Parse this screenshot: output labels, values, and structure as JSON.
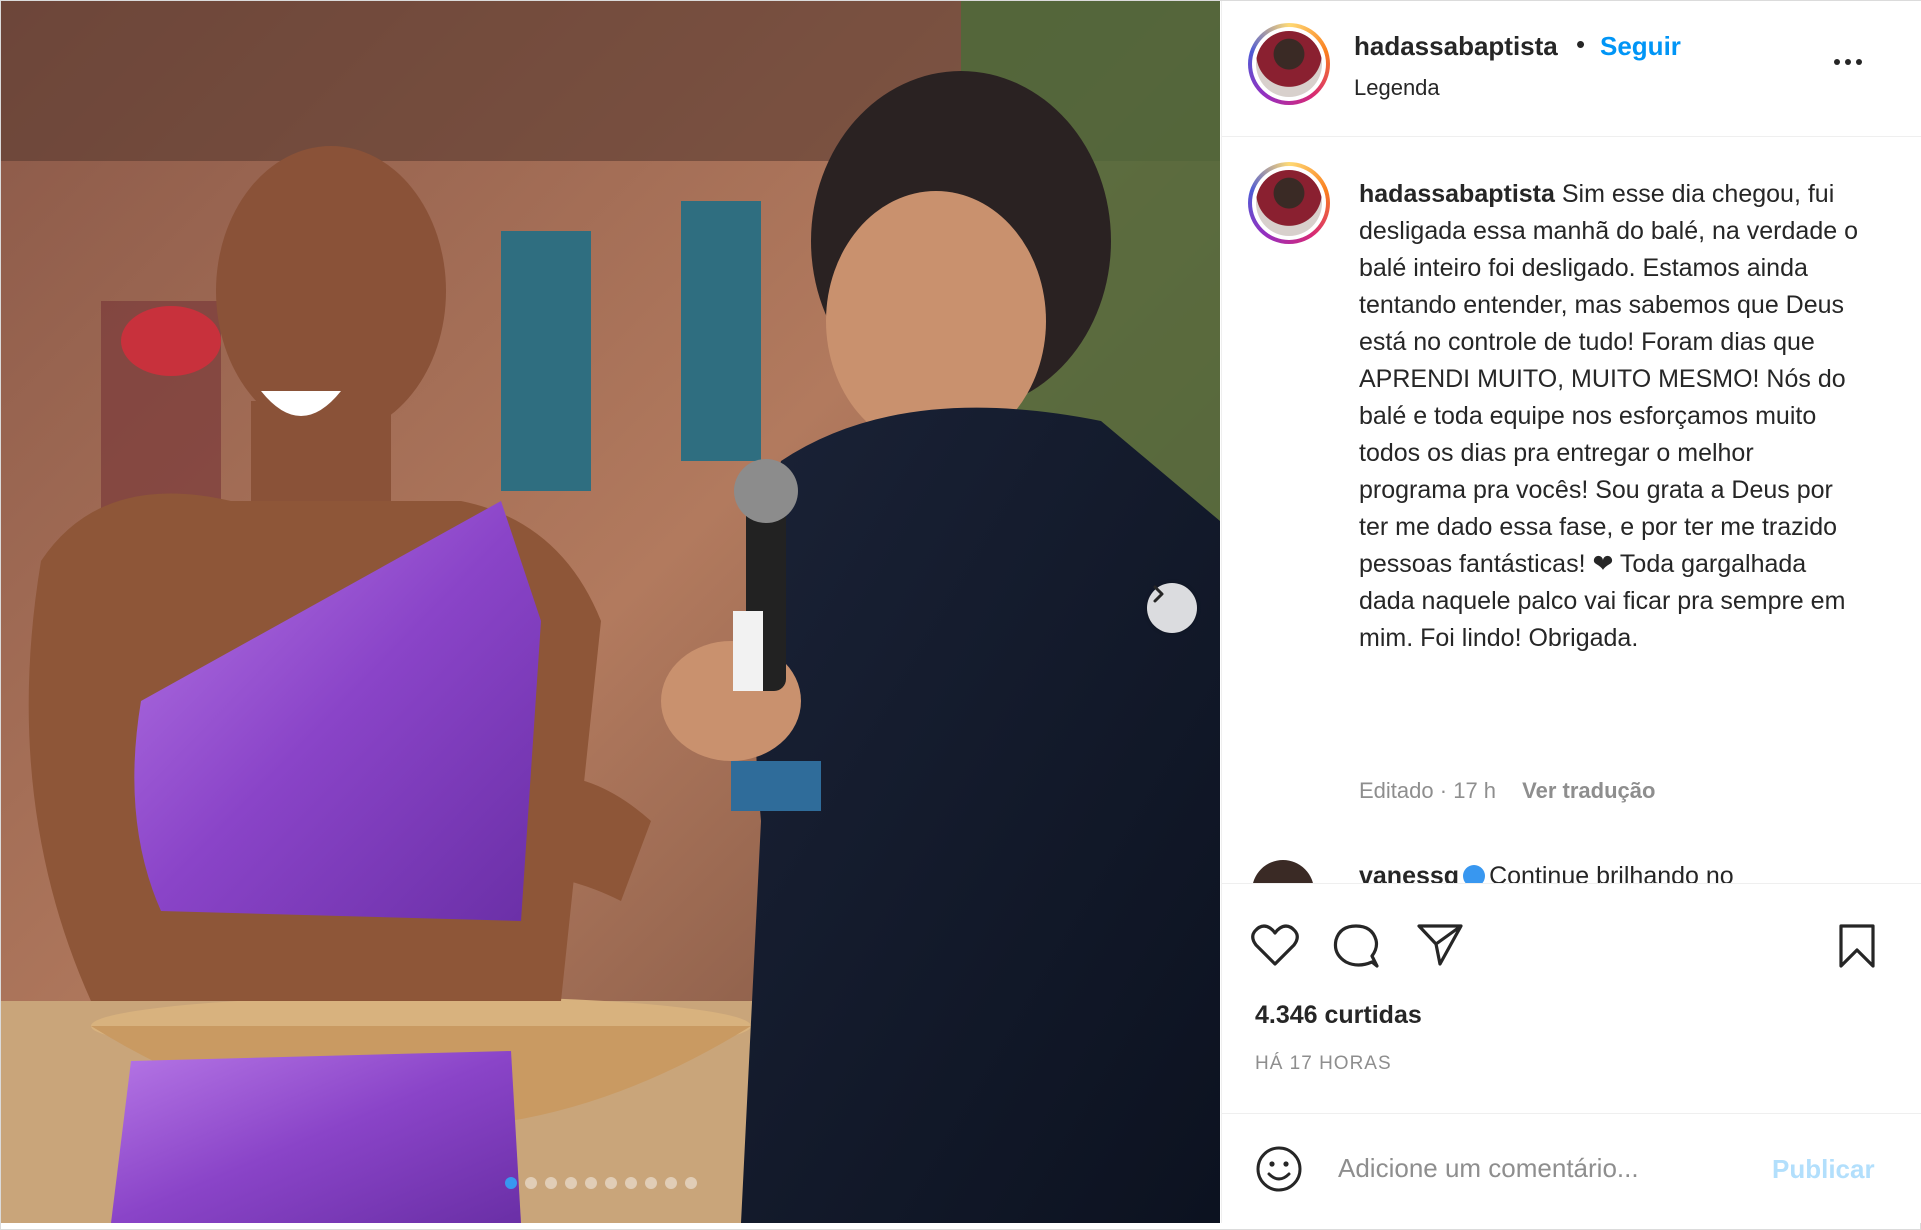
{
  "post": {
    "username": "hadassabaptista",
    "separator": "•",
    "follow_label": "Seguir",
    "subtitle": "Legenda",
    "more_icon": "more-horizontal-icon"
  },
  "caption": {
    "username": "hadassabaptista",
    "text_before_heart": "Sim esse dia chegou, fui desligada essa manhã do balé, na verdade o balé inteiro foi desligado. Estamos ainda tentando entender, mas sabemos que Deus está no controle de tudo! Foram dias que APRENDI MUITO, MUITO MESMO! Nós do balé e toda equipe nos esforçamos muito todos os dias pra entregar o melhor programa pra vocês! Sou grata a Deus por ter me dado essa fase, e por ter me trazido pessoas fantásticas!",
    "heart": "❤",
    "text_after_heart": "Toda gargalhada dada naquele palco vai ficar pra sempre em mim. Foi lindo! Obrigada.",
    "edited": "Editado",
    "dot": "·",
    "age": "17 h",
    "translate": "Ver tradução"
  },
  "next_comment": {
    "username": "vanessg",
    "text": "Continue brilhando no"
  },
  "actions": {
    "like_icon": "heart-icon",
    "comment_icon": "comment-icon",
    "share_icon": "send-icon",
    "save_icon": "bookmark-icon"
  },
  "likes": "4.346 curtidas",
  "timestamp": "HÁ 17 HORAS",
  "comment_box": {
    "emoji_icon": "smiley-icon",
    "placeholder": "Adicione um comentário...",
    "publish_label": "Publicar"
  },
  "carousel": {
    "total_slides": 10,
    "active_slide": 1,
    "next_icon": "chevron-right-icon"
  },
  "colors": {
    "link_blue": "#0095f6",
    "publish_disabled": "#b2dffc",
    "text": "#262626",
    "muted": "#8e8e8e"
  }
}
